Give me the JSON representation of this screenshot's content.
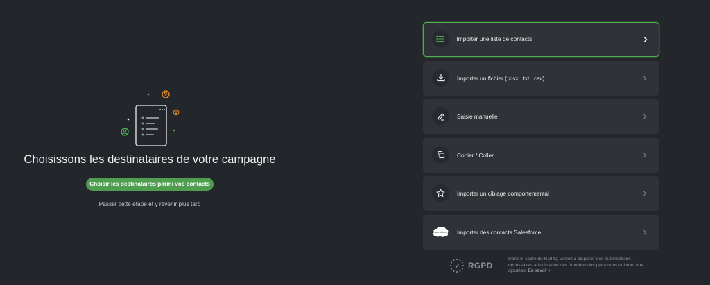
{
  "hero": {
    "headline": "Choisissons les destinataires de votre campagne",
    "cta_label": "Choisir les destinataires parmi vos contacts",
    "skip_label": "Passer cette étape et y revenir plus tard"
  },
  "options": [
    {
      "label": "Importer une liste de contacts",
      "icon": "list-icon",
      "selected": true
    },
    {
      "label": "Importer un fichier (.xlsx, .txt, .csv)",
      "icon": "download-icon",
      "selected": false
    },
    {
      "label": "Saisie manuelle",
      "icon": "pencil-icon",
      "selected": false
    },
    {
      "label": "Copier / Coller",
      "icon": "copy-icon",
      "selected": false
    },
    {
      "label": "Importer un ciblage comportemental",
      "icon": "star-icon",
      "selected": false
    },
    {
      "label": "Importer des contacts Salesforce",
      "icon": "salesforce-icon",
      "selected": false
    }
  ],
  "rgpd": {
    "logo_text": "RGPD",
    "note": "Dans le cadre du RGPD, veillez à disposer des autorisations nécessaires à l'utilisation des données des personnes qui vont être ajoutées.",
    "link_label": "En savoir +"
  },
  "colors": {
    "background": "#23262a",
    "card": "#2f3237",
    "accent_green": "#4f9d4f",
    "selected_border": "#4fae4f",
    "orange": "#d9822b"
  }
}
